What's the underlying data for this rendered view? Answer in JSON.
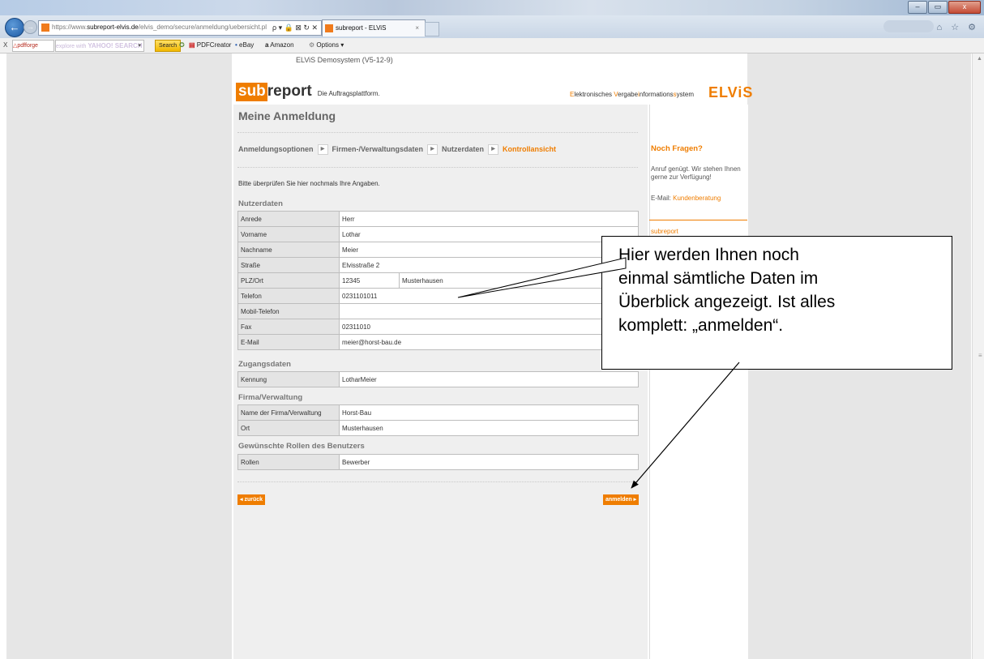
{
  "browser": {
    "url_prefix": "https://www.",
    "url_host": "subreport-elvis.de",
    "url_path": "/elvis_demo/secure/anmeldung/uebersicht.pl",
    "address_tools": "ρ ▾ 🔒 ⊠ ↻ ✕",
    "tab_title": "subreport - ELViS",
    "tab_close": "×",
    "window_buttons": [
      "–",
      "▭",
      "x"
    ],
    "toolbar": {
      "close": "X",
      "pdfforge": "pdfforge",
      "yahoo_prefix": "explore with",
      "yahoo_logo": "YAHOO! SEARCH",
      "search_button": "Search",
      "pdfcreator": "PDFCreator",
      "ebay": "eBay",
      "amazon": "Amazon",
      "options": "Options ▾"
    },
    "nav_icons": "⌂ ☆ ⚙"
  },
  "header": {
    "demo_label": "ELViS Demosystem (V5-12-9)",
    "logo_sub": "sub",
    "logo_report": "report",
    "slogan": "Die Auftragsplattform.",
    "elvis_parts": [
      {
        "t": "E",
        "o": true
      },
      {
        "t": "lektronisches ",
        "o": false
      },
      {
        "t": "V",
        "o": true
      },
      {
        "t": "ergabe",
        "o": false
      },
      {
        "t": "i",
        "o": true
      },
      {
        "t": "nformations",
        "o": false
      },
      {
        "t": "s",
        "o": true
      },
      {
        "t": "ystem",
        "o": false
      }
    ],
    "elvis_logo": "ELViS",
    "brand_color": "#ef7d00"
  },
  "main": {
    "title": "Meine Anmeldung",
    "steps": [
      {
        "label": "Anmeldungsoptionen",
        "active": false
      },
      {
        "label": "Firmen-/Verwaltungsdaten",
        "active": false
      },
      {
        "label": "Nutzerdaten",
        "active": false
      },
      {
        "label": "Kontrollansicht",
        "active": true
      }
    ],
    "intro": "Bitte überprüfen Sie hier nochmals Ihre Angaben.",
    "sections": {
      "nutzerdaten": {
        "title": "Nutzerdaten",
        "rows": [
          {
            "label": "Anrede",
            "value": "Herr"
          },
          {
            "label": "Vorname",
            "value": "Lothar"
          },
          {
            "label": "Nachname",
            "value": "Meier"
          },
          {
            "label": "Straße",
            "value": "Elvisstraße 2"
          },
          {
            "label": "PLZ/Ort",
            "plz": "12345",
            "ort": "Musterhausen"
          },
          {
            "label": "Telefon",
            "value": "0231101011"
          },
          {
            "label": "Mobil-Telefon",
            "value": ""
          },
          {
            "label": "Fax",
            "value": "02311010"
          },
          {
            "label": "E-Mail",
            "value": "meier@horst-bau.de"
          }
        ]
      },
      "zugangsdaten": {
        "title": "Zugangsdaten",
        "rows": [
          {
            "label": "Kennung",
            "value": "LotharMeier"
          }
        ]
      },
      "firma": {
        "title": "Firma/Verwaltung",
        "rows": [
          {
            "label": "Name der Firma/Verwaltung",
            "value": "Horst-Bau"
          },
          {
            "label": "Ort",
            "value": "Musterhausen"
          }
        ]
      },
      "rollen": {
        "title": "Gewünschte Rollen des Benutzers",
        "rows": [
          {
            "label": "Rollen",
            "value": "Bewerber"
          }
        ]
      }
    },
    "back_button": "◂ zurück",
    "submit_button": "anmelden ▸"
  },
  "sidebar": {
    "title": "Noch Fragen?",
    "text": "Anruf genügt. Wir stehen Ihnen gerne zur Verfügung!",
    "email_label": "E-Mail:",
    "email_link": "Kundenberatung",
    "subreport_link": "subreport"
  },
  "callout": {
    "lines": [
      "Hier werden Ihnen noch",
      "einmal sämtliche Daten im",
      "Überblick angezeigt. Ist alles",
      "komplett: „anmelden“."
    ]
  }
}
